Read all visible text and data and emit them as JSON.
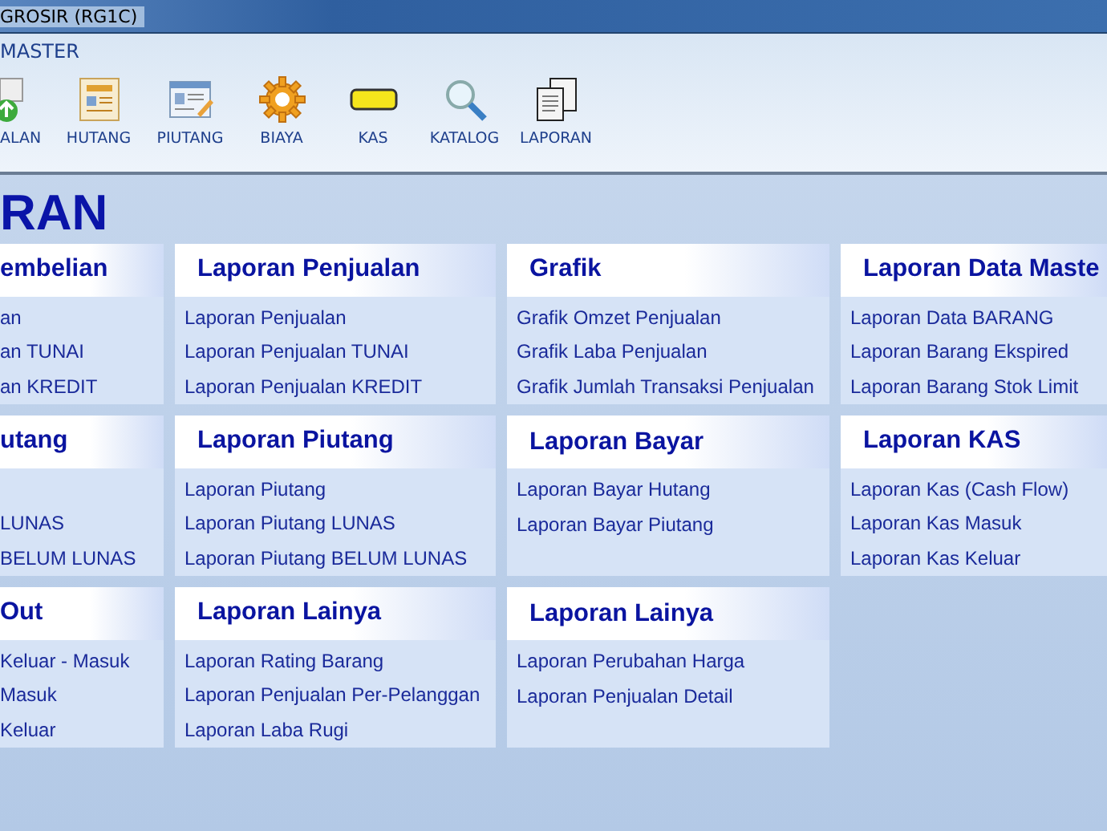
{
  "window": {
    "title": "GROSIR (RG1C)"
  },
  "menu": {
    "label": "MASTER"
  },
  "toolbar": [
    {
      "kind": "upload",
      "label": "ALAN"
    },
    {
      "kind": "document",
      "label": "HUTANG"
    },
    {
      "kind": "form",
      "label": "PIUTANG"
    },
    {
      "kind": "gear",
      "label": "BIAYA"
    },
    {
      "kind": "bar",
      "label": "KAS"
    },
    {
      "kind": "search",
      "label": "KATALOG"
    },
    {
      "kind": "copies",
      "label": "LAPORAN"
    }
  ],
  "page_title": "RAN",
  "cards": [
    {
      "title": "embelian",
      "items": [
        "an",
        "an TUNAI",
        "an KREDIT"
      ]
    },
    {
      "title": "Laporan Penjualan",
      "items": [
        "Laporan Penjualan",
        "Laporan Penjualan TUNAI",
        "Laporan Penjualan KREDIT"
      ]
    },
    {
      "title": "Grafik",
      "items": [
        "Grafik Omzet Penjualan",
        "Grafik Laba Penjualan",
        "Grafik Jumlah Transaksi Penjualan"
      ]
    },
    {
      "title": "Laporan Data Maste",
      "items": [
        "Laporan Data BARANG",
        "Laporan Barang Ekspired",
        "Laporan Barang Stok Limit"
      ]
    },
    {
      "title": "utang",
      "blank_first_row": true,
      "items": [
        "LUNAS",
        "BELUM LUNAS"
      ]
    },
    {
      "title": "Laporan Piutang",
      "items": [
        "Laporan Piutang",
        "Laporan Piutang LUNAS",
        "Laporan Piutang BELUM LUNAS"
      ]
    },
    {
      "title": "Laporan Bayar",
      "items": [
        "Laporan Bayar Hutang",
        "Laporan Bayar Piutang"
      ]
    },
    {
      "title": "Laporan KAS",
      "items": [
        "Laporan Kas (Cash Flow)",
        "Laporan Kas Masuk",
        "Laporan Kas Keluar"
      ]
    },
    {
      "title": "Out",
      "items": [
        "Keluar - Masuk",
        "Masuk",
        "Keluar"
      ]
    },
    {
      "title": "Laporan Lainya",
      "items": [
        "Laporan Rating Barang",
        "Laporan Penjualan Per-Pelanggan",
        "Laporan Laba Rugi"
      ]
    },
    {
      "title": "Laporan Lainya",
      "items": [
        "Laporan Perubahan Harga",
        "Laporan Penjualan Detail"
      ]
    }
  ]
}
